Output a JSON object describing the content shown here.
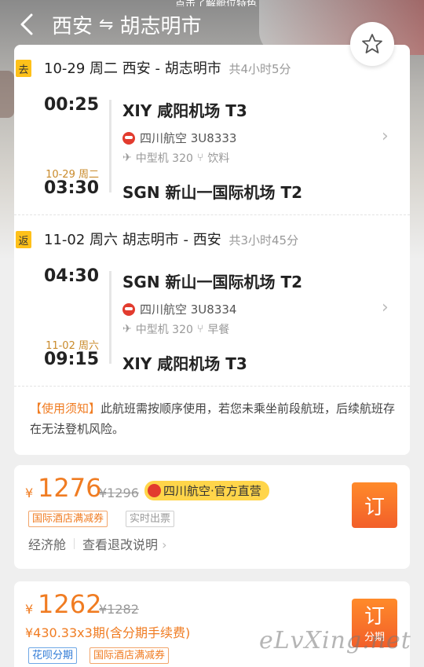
{
  "header": {
    "topline": "点击了解舱位特色",
    "origin": "西安",
    "arrow": "⇋",
    "destination": "胡志明市"
  },
  "segments": [
    {
      "tag": "去",
      "date": "10-29",
      "weekday": "周二",
      "route": "西安 - 胡志明市",
      "duration": "共4小时5分",
      "dep_time": "00:25",
      "dep_airport": "XIY 咸阳机场 T3",
      "airline": "四川航空 3U8333",
      "aircraft": "中型机 320",
      "meal": "饮料",
      "arr_date": "10-29 周二",
      "arr_time": "03:30",
      "arr_airport": "SGN 新山一国际机场 T2"
    },
    {
      "tag": "返",
      "date": "11-02",
      "weekday": "周六",
      "route": "胡志明市 - 西安",
      "duration": "共3小时45分",
      "dep_time": "04:30",
      "dep_airport": "SGN 新山一国际机场 T2",
      "airline": "四川航空 3U8334",
      "aircraft": "中型机 320",
      "meal": "早餐",
      "arr_date": "11-02 周六",
      "arr_time": "09:15",
      "arr_airport": "XIY 咸阳机场 T3"
    }
  ],
  "notice": {
    "key": "【使用须知】",
    "text": "此航班需按顺序使用，若您未乘坐前段航班，后续航班存在无法登机风险。"
  },
  "offers": [
    {
      "currency": "¥",
      "price": "1276",
      "old_price": "¥1296",
      "official": "四川航空·官方直营",
      "tags": [
        "国际酒店满减券",
        "实时出票"
      ],
      "cabin": "经济舱",
      "refund_link": "查看退改说明",
      "book": "订"
    },
    {
      "currency": "¥",
      "price": "1262",
      "old_price": "¥1282",
      "installment": "¥430.33x3期(含分期手续费)",
      "tags": [
        "花呗分期",
        "国际酒店满减券"
      ],
      "book": "订",
      "book_sub": "分期"
    }
  ],
  "watermark": "eLvXing.net",
  "icons": {
    "back": "chevron-left-icon",
    "favorite": "star-icon",
    "plane": "plane-icon",
    "meal": "fork-knife-icon",
    "expand": "chevron-right-icon"
  },
  "colors": {
    "accent": "#f07c22",
    "tag_yellow": "#ffc11a",
    "airline_red": "#e23b2e"
  }
}
